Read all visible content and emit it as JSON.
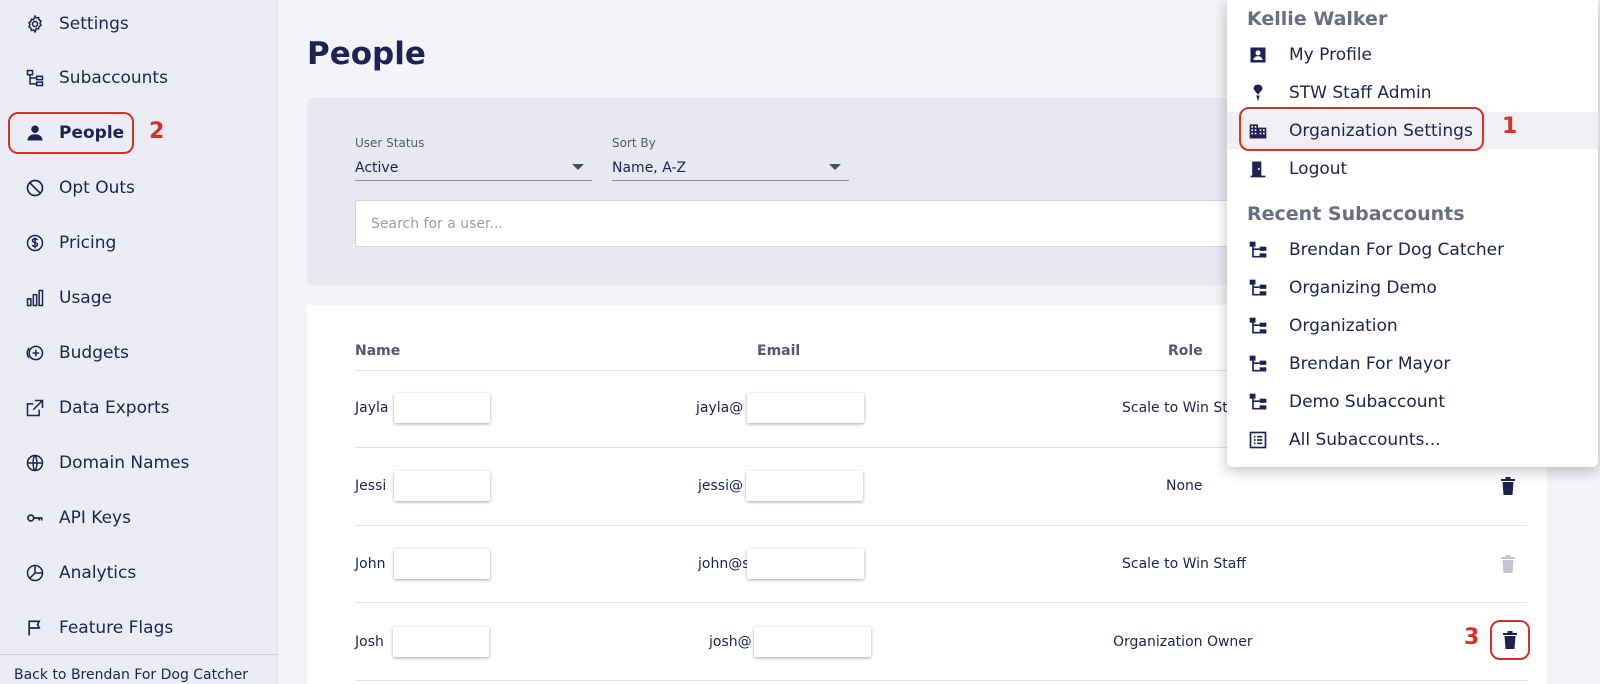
{
  "sidebar": {
    "items": [
      {
        "label": "Settings",
        "icon": "gear-icon"
      },
      {
        "label": "Subaccounts",
        "icon": "subaccounts-icon"
      },
      {
        "label": "People",
        "icon": "person-icon"
      },
      {
        "label": "Opt Outs",
        "icon": "block-icon"
      },
      {
        "label": "Pricing",
        "icon": "dollar-icon"
      },
      {
        "label": "Usage",
        "icon": "bar-chart-icon"
      },
      {
        "label": "Budgets",
        "icon": "budget-icon"
      },
      {
        "label": "Data Exports",
        "icon": "export-icon"
      },
      {
        "label": "Domain Names",
        "icon": "globe-icon"
      },
      {
        "label": "API Keys",
        "icon": "key-icon"
      },
      {
        "label": "Analytics",
        "icon": "pie-chart-icon"
      },
      {
        "label": "Feature Flags",
        "icon": "flag-icon"
      }
    ],
    "back_link": "Back to Brendan For Dog Catcher"
  },
  "annotations": {
    "one": "1",
    "two": "2",
    "three": "3"
  },
  "main": {
    "title": "People",
    "filters": {
      "user_status_label": "User Status",
      "user_status_value": "Active",
      "sort_by_label": "Sort By",
      "sort_by_value": "Name, A-Z"
    },
    "search": {
      "placeholder": "Search for a user..."
    },
    "table": {
      "headers": {
        "name": "Name",
        "email": "Email",
        "role": "Role"
      },
      "rows": [
        {
          "name": "Jayla",
          "email": "jayla@",
          "role": "Scale to Win Staff"
        },
        {
          "name": "Jessi",
          "email": "jessi@",
          "role": "None"
        },
        {
          "name": "John",
          "email": "john@s",
          "role": "Scale to Win Staff"
        },
        {
          "name": "Josh",
          "email": "josh@",
          "role": "Organization Owner"
        }
      ]
    }
  },
  "menu": {
    "user_name": "Kellie Walker",
    "items": [
      {
        "label": "My Profile",
        "icon": "profile-icon"
      },
      {
        "label": "STW Staff Admin",
        "icon": "staff-admin-icon"
      },
      {
        "label": "Organization Settings",
        "icon": "building-icon"
      },
      {
        "label": "Logout",
        "icon": "logout-icon"
      }
    ],
    "recent_heading": "Recent Subaccounts",
    "recent": [
      {
        "label": "Brendan For Dog Catcher"
      },
      {
        "label": "Organizing Demo"
      },
      {
        "label": "Organization"
      },
      {
        "label": "Brendan For Mayor"
      },
      {
        "label": "Demo Subaccount"
      }
    ],
    "all_subaccounts": "All Subaccounts..."
  },
  "colors": {
    "accent": "#1e2152",
    "annotation": "#d93024"
  }
}
